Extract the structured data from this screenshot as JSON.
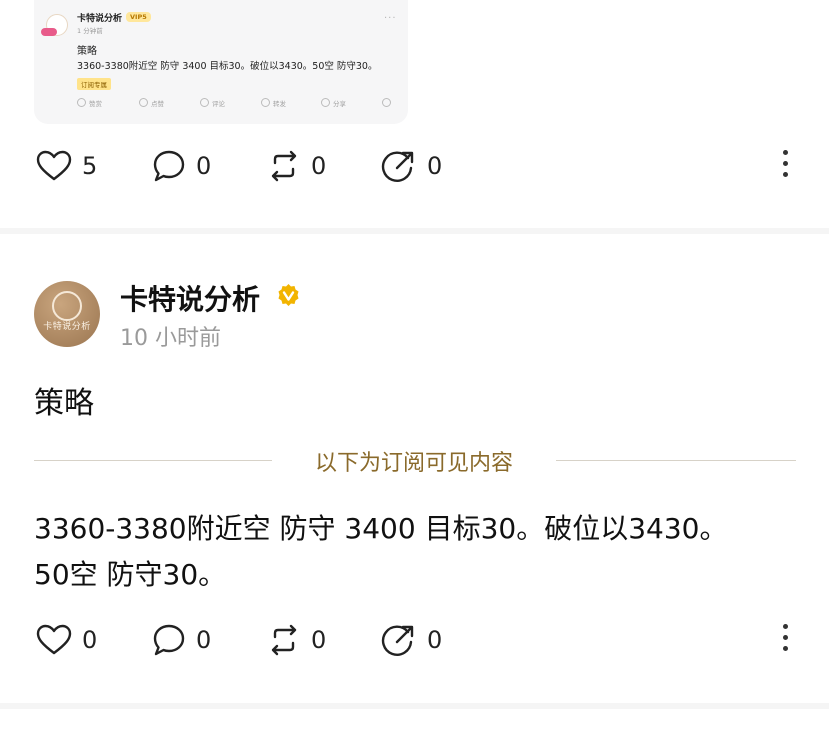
{
  "embedded_preview": {
    "author": "卡特说分析",
    "badge": "VIP5",
    "time": "1 分钟前",
    "title": "策略",
    "body": "3360-3380附近空 防守 3400 目标30。破位以3430。50空 防守30。",
    "tag": "订阅专属",
    "actions": [
      "赞赏",
      "点赞",
      "评论",
      "转发",
      "分享"
    ],
    "more_icon": "ellipsis-icon"
  },
  "top_actions": {
    "like_count": "5",
    "comment_count": "0",
    "repost_count": "0",
    "share_count": "0"
  },
  "post": {
    "author": "卡特说分析",
    "verified_icon": "verified-badge-icon",
    "time": "10 小时前",
    "title": "策略",
    "subscriber_divider": "以下为订阅可见内容",
    "body": "3360-3380附近空 防守 3400 目标30。破位以3430。50空 防守30。",
    "actions": {
      "like_count": "0",
      "comment_count": "0",
      "repost_count": "0",
      "share_count": "0"
    }
  },
  "colors": {
    "accent_gold": "#8a6a2b",
    "verified": "#f2b400",
    "divider": "#d7d2c8"
  }
}
